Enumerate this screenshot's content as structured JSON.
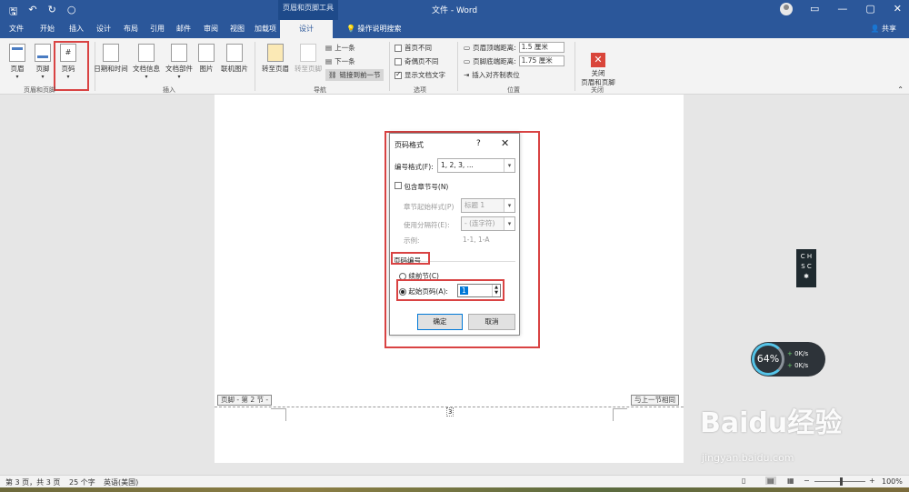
{
  "titlebar": {
    "qat_save": "🖫",
    "qat_undo": "↶",
    "qat_redo": "↻",
    "qat_more": "○",
    "context_tool": "页眉和页脚工具",
    "doc_title": "文件 - Word",
    "restore": "▭",
    "minimize": "—",
    "maximize": "▢",
    "close": "✕"
  },
  "tabs": [
    "文件",
    "开始",
    "插入",
    "设计",
    "布局",
    "引用",
    "邮件",
    "审阅",
    "视图",
    "加载项"
  ],
  "active_tab": "设计",
  "tell_me": "操作说明搜索",
  "share": "共享",
  "ribbon": {
    "header_label": "页眉",
    "footer_label": "页脚",
    "pagenum_label": "页码",
    "group_hf": "页眉和页脚",
    "datetime_label": "日期和时间",
    "docinfo_label": "文档信息",
    "docparts_label": "文档部件",
    "picture_label": "图片",
    "onlinepic_label": "联机图片",
    "group_insert": "插入",
    "goto_header": "转至页眉",
    "goto_footer": "转至页脚",
    "prev": "上一条",
    "next": "下一条",
    "link_prev": "链接到前一节",
    "group_nav": "导航",
    "diff_first": "首页不同",
    "diff_oddeven": "奇偶页不同",
    "show_text": "显示文档文字",
    "group_options": "选项",
    "header_top": "页眉顶端距离:",
    "header_top_val": "1.5 厘米",
    "footer_bottom": "页脚底端距离:",
    "footer_bottom_val": "1.75 厘米",
    "insert_align": "插入对齐制表位",
    "group_position": "位置",
    "close_label": "关闭\n页眉和页脚",
    "group_close": "关闭"
  },
  "page": {
    "footer_tag": "页脚 - 第 2 节 -",
    "same_as_prev": "与上一节相同",
    "page_number": "3"
  },
  "dialog": {
    "title": "页码格式",
    "help": "?",
    "close": "✕",
    "format_label": "编号格式(F):",
    "format_value": "1, 2, 3, ...",
    "include_chapter": "包含章节号(N)",
    "chapter_style_label": "章节起始样式(P)",
    "chapter_style_value": "标题 1",
    "separator_label": "使用分隔符(E):",
    "separator_value": "-  (连字符)",
    "example_label": "示例:",
    "example_value": "1-1, 1-A",
    "section_title": "页码编号",
    "continue_label": "续前节(C)",
    "start_at_label": "起始页码(A):",
    "start_at_value": "1",
    "ok": "确定",
    "cancel": "取消"
  },
  "overlay": {
    "ime_line1": "C H",
    "ime_line2": "S C",
    "ime_icon": "✱",
    "speed_percent": "64%",
    "up_rate": "0K/s",
    "down_rate": "0K/s",
    "watermark": "Baidu经验",
    "watermark_url": "jingyan.baidu.com"
  },
  "status": {
    "page": "第 3 页，共 3 页",
    "words": "25 个字",
    "lang": "英语(美国)",
    "zoom": "100%"
  }
}
